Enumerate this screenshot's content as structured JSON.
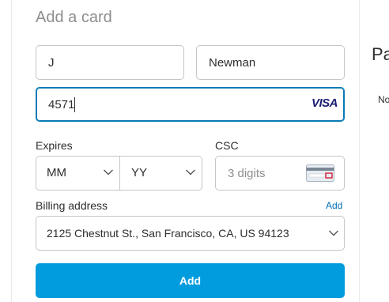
{
  "form": {
    "title": "Add a card",
    "first_name": {
      "value": "J",
      "placeholder": ""
    },
    "last_name": {
      "value": "Newman",
      "placeholder": ""
    },
    "card_number": {
      "value": "4571",
      "brand": "VISA"
    },
    "expires": {
      "label": "Expires",
      "month": "MM",
      "year": "YY"
    },
    "csc": {
      "label": "CSC",
      "placeholder": "3 digits",
      "icon": "card-back-icon"
    },
    "billing": {
      "label": "Billing address",
      "add_link": "Add",
      "selected": "2125 Chestnut St., San Francisco, CA, US 94123"
    },
    "submit_label": "Add"
  },
  "side_panel": {
    "heading": "Pa",
    "text": "No"
  },
  "colors": {
    "primary_button": "#009cde",
    "link": "#0070ba",
    "focus_border": "#0a7bb5",
    "visa_blue": "#1a1f71",
    "visa_gold": "#f7a600"
  }
}
